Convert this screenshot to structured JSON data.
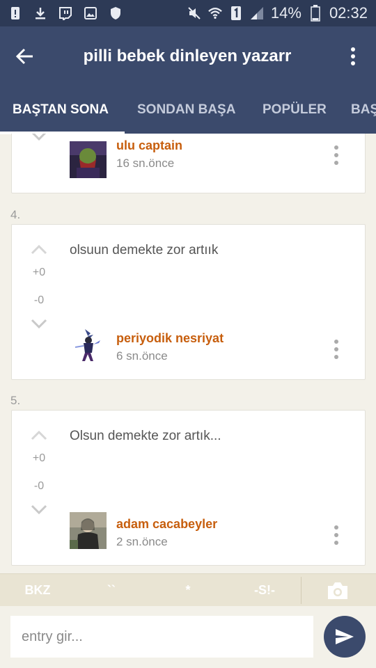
{
  "status_bar": {
    "battery_percent": "14%",
    "time": "02:32",
    "left_icons": [
      "alert-icon",
      "download-icon",
      "twitch-icon",
      "image-icon",
      "shield-icon"
    ],
    "right_icons": [
      "mute-icon",
      "wifi-icon",
      "sim-1-icon",
      "signal-icon",
      "battery-icon"
    ]
  },
  "app_bar": {
    "title": "pilli bebek dinleyen yazarr",
    "back_icon": "arrow-left-icon",
    "menu_icon": "more-vertical-icon"
  },
  "tabs": [
    {
      "label": "BAŞTAN SONA",
      "active": true
    },
    {
      "label": "SONDAN BAŞA",
      "active": false
    },
    {
      "label": "POPÜLER",
      "active": false
    },
    {
      "label": "BAŞ",
      "active": false
    }
  ],
  "entries": [
    {
      "number": "",
      "text": "",
      "upvotes": "",
      "downvotes": "",
      "author": "ulu captain",
      "time": "16 sn.önce"
    },
    {
      "number": "4.",
      "text": "olsuun demekte zor artıık",
      "upvotes": "+0",
      "downvotes": "-0",
      "author": "periyodik nesriyat",
      "time": "6 sn.önce"
    },
    {
      "number": "5.",
      "text": "Olsun demekte zor artık...",
      "upvotes": "+0",
      "downvotes": "-0",
      "author": "adam cacabeyler",
      "time": "2 sn.önce"
    }
  ],
  "toolbar": {
    "bkz": "BKZ",
    "backtick": "``",
    "star": "*",
    "spoiler": "-S!-",
    "camera_icon": "camera-icon"
  },
  "composer": {
    "placeholder": "entry gir...",
    "value": "",
    "send_icon": "send-icon"
  },
  "colors": {
    "primary": "#3b4a6c",
    "accent": "#c75e0d",
    "background": "#f3f1e9"
  }
}
